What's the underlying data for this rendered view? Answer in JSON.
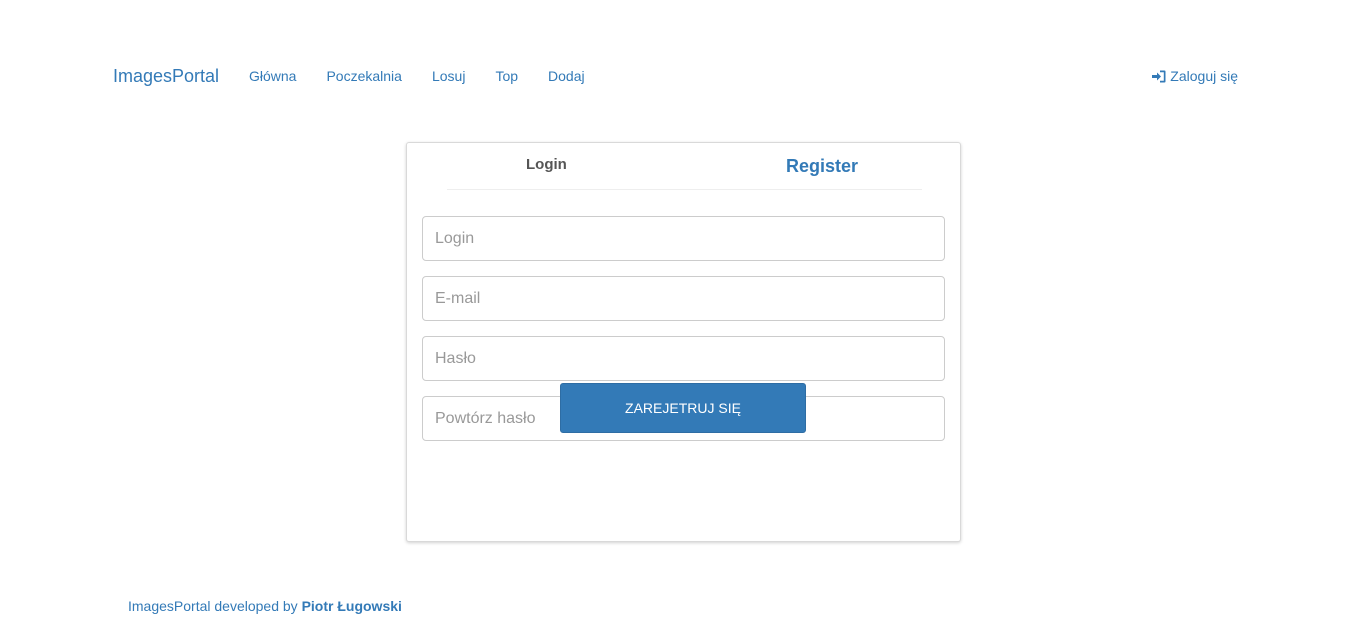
{
  "navbar": {
    "brand": "ImagesPortal",
    "links": [
      "Główna",
      "Poczekalnia",
      "Losuj",
      "Top",
      "Dodaj"
    ],
    "login": "Zaloguj się",
    "login_icon": "sign-in-icon",
    "accent_color": "#337ab7"
  },
  "panel": {
    "tabs": {
      "login": "Login",
      "register": "Register"
    },
    "fields": {
      "login_placeholder": "Login",
      "email_placeholder": "E-mail",
      "password_placeholder": "Hasło",
      "repeat_password_placeholder": "Powtórz hasło"
    },
    "submit": "ZAREJETRUJ SIĘ"
  },
  "footer": {
    "text": "ImagesPortal developed by",
    "author": "Piotr Ługowski"
  }
}
